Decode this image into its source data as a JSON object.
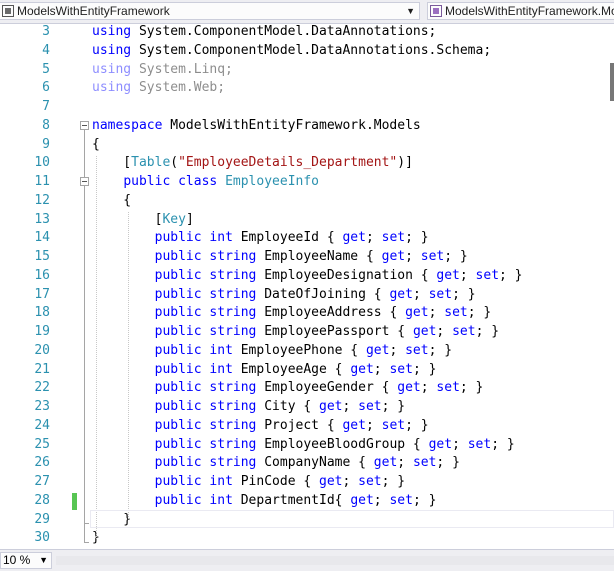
{
  "navbar": {
    "project": "ModelsWithEntityFramework",
    "type_member": "ModelsWithEntityFramework.Models.EmployeeInfo",
    "project_icon": "csharp-project-icon",
    "type_icon": "class-icon"
  },
  "editor": {
    "lines": [
      {
        "n": "3",
        "html": "<span class=\"kw\">using</span> System.ComponentModel.DataAnnotations;"
      },
      {
        "n": "4",
        "html": "<span class=\"kw\">using</span> System.ComponentModel.DataAnnotations.Schema;"
      },
      {
        "n": "5",
        "html": "<span class=\"kw\">using</span> System.Linq;",
        "faded": true
      },
      {
        "n": "6",
        "html": "<span class=\"kw\">using</span> System.Web;",
        "faded": true
      },
      {
        "n": "7",
        "html": ""
      },
      {
        "n": "8",
        "html": "<span class=\"kw\">namespace</span> ModelsWithEntityFramework.Models"
      },
      {
        "n": "9",
        "html": "{"
      },
      {
        "n": "10",
        "html": "    [<span class=\"ty\">Table</span>(<span class=\"st\">\"EmployeeDetails_Department\"</span>)]"
      },
      {
        "n": "11",
        "html": "    <span class=\"kw\">public</span> <span class=\"kw\">class</span> <span class=\"ty\">EmployeeInfo</span>"
      },
      {
        "n": "12",
        "html": "    {"
      },
      {
        "n": "13",
        "html": "        [<span class=\"ty\">Key</span>]"
      },
      {
        "n": "14",
        "html": "        <span class=\"kw\">public</span> <span class=\"kw\">int</span> EmployeeId { <span class=\"kw\">get</span>; <span class=\"kw\">set</span>; }"
      },
      {
        "n": "15",
        "html": "        <span class=\"kw\">public</span> <span class=\"kw\">string</span> EmployeeName { <span class=\"kw\">get</span>; <span class=\"kw\">set</span>; }"
      },
      {
        "n": "16",
        "html": "        <span class=\"kw\">public</span> <span class=\"kw\">string</span> EmployeeDesignation { <span class=\"kw\">get</span>; <span class=\"kw\">set</span>; }"
      },
      {
        "n": "17",
        "html": "        <span class=\"kw\">public</span> <span class=\"kw\">string</span> DateOfJoining { <span class=\"kw\">get</span>; <span class=\"kw\">set</span>; }"
      },
      {
        "n": "18",
        "html": "        <span class=\"kw\">public</span> <span class=\"kw\">string</span> EmployeeAddress { <span class=\"kw\">get</span>; <span class=\"kw\">set</span>; }"
      },
      {
        "n": "19",
        "html": "        <span class=\"kw\">public</span> <span class=\"kw\">string</span> EmployeePassport { <span class=\"kw\">get</span>; <span class=\"kw\">set</span>; }"
      },
      {
        "n": "20",
        "html": "        <span class=\"kw\">public</span> <span class=\"kw\">int</span> EmployeePhone { <span class=\"kw\">get</span>; <span class=\"kw\">set</span>; }"
      },
      {
        "n": "21",
        "html": "        <span class=\"kw\">public</span> <span class=\"kw\">int</span> EmployeeAge { <span class=\"kw\">get</span>; <span class=\"kw\">set</span>; }"
      },
      {
        "n": "22",
        "html": "        <span class=\"kw\">public</span> <span class=\"kw\">string</span> EmployeeGender { <span class=\"kw\">get</span>; <span class=\"kw\">set</span>; }"
      },
      {
        "n": "23",
        "html": "        <span class=\"kw\">public</span> <span class=\"kw\">string</span> City { <span class=\"kw\">get</span>; <span class=\"kw\">set</span>; }"
      },
      {
        "n": "24",
        "html": "        <span class=\"kw\">public</span> <span class=\"kw\">string</span> Project { <span class=\"kw\">get</span>; <span class=\"kw\">set</span>; }"
      },
      {
        "n": "25",
        "html": "        <span class=\"kw\">public</span> <span class=\"kw\">string</span> EmployeeBloodGroup { <span class=\"kw\">get</span>; <span class=\"kw\">set</span>; }"
      },
      {
        "n": "26",
        "html": "        <span class=\"kw\">public</span> <span class=\"kw\">string</span> CompanyName { <span class=\"kw\">get</span>; <span class=\"kw\">set</span>; }"
      },
      {
        "n": "27",
        "html": "        <span class=\"kw\">public</span> <span class=\"kw\">int</span> PinCode { <span class=\"kw\">get</span>; <span class=\"kw\">set</span>; }"
      },
      {
        "n": "28",
        "html": "        <span class=\"kw\">public</span> <span class=\"kw\">int</span> DepartmentId{ <span class=\"kw\">get</span>; <span class=\"kw\">set</span>; }"
      },
      {
        "n": "29",
        "html": "    }"
      },
      {
        "n": "30",
        "html": "}"
      }
    ]
  },
  "status": {
    "zoom": "10 %"
  },
  "colors": {
    "keyword": "#0000ff",
    "type": "#2b91af",
    "string": "#a31515",
    "line_number": "#2b91af",
    "change_marker": "#57c553"
  }
}
